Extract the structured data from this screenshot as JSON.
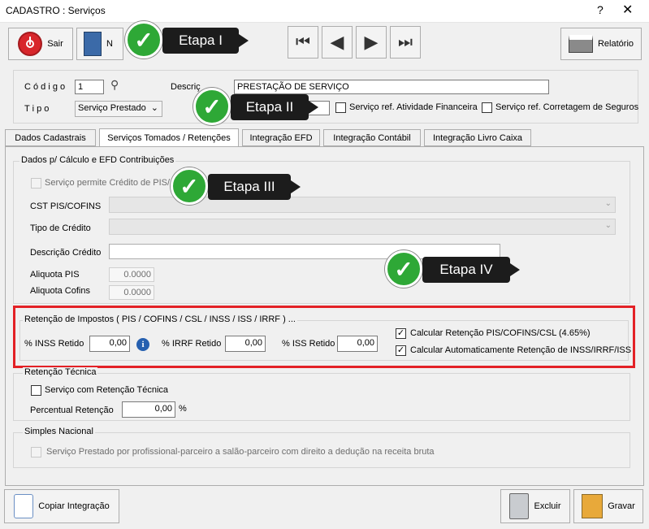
{
  "window": {
    "title": "CADASTRO : Serviços",
    "help": "?",
    "close": "✕"
  },
  "toolbar": {
    "exit_label": "Sair",
    "new_label": "N",
    "report_label": "Relatório"
  },
  "header": {
    "code_label": "C ó d i g o",
    "code_value": "1",
    "description_label": "Descriç",
    "description_value": "PRESTAÇÃO DE SERVIÇO",
    "type_label": "T i p o",
    "type_value": "Serviço Prestado",
    "chk_financial_label": "Serviço ref. Atividade Financeira",
    "chk_insurance_label": "Serviço ref. Corretagem de Seguros"
  },
  "tabs": [
    {
      "label": "Dados Cadastrais"
    },
    {
      "label": "Serviços Tomados / Retenções"
    },
    {
      "label": "Integração EFD"
    },
    {
      "label": "Integração Contábil"
    },
    {
      "label": "Integração Livro Caixa"
    }
  ],
  "pis_section": {
    "legend": "Dados p/ Cálculo e EFD Contribuições",
    "credit_check_label": "Serviço permite Crédito de PIS/",
    "cst_label": "CST PIS/COFINS",
    "credit_type_label": "Tipo de Crédito",
    "credit_desc_label": "Descrição Crédito",
    "aliq_pis_label": "Aliquota  PIS",
    "aliq_pis_value": "0.0000",
    "aliq_cofins_label": "Aliquota  Cofins",
    "aliq_cofins_value": "0.0000"
  },
  "retention": {
    "legend": "Retenção de Impostos ( PIS / COFINS / CSL / INSS / ISS / IRRF )  ...",
    "inss_label": "% INSS Retido",
    "inss_value": "0,00",
    "irrf_label": "% IRRF Retido",
    "irrf_value": "0,00",
    "iss_label": "% ISS Retido",
    "iss_value": "0,00",
    "calc_pis_label": "Calcular Retenção PIS/COFINS/CSL (4.65%)",
    "calc_auto_label": "Calcular Automaticamente Retenção de INSS/IRRF/ISS"
  },
  "technical": {
    "legend": "Retenção Técnica",
    "check_label": "Serviço com Retenção Técnica",
    "percent_label": "Percentual Retenção",
    "percent_value": "0,00",
    "percent_sign": "%"
  },
  "simples": {
    "legend": "Simples Nacional",
    "check_label": "Serviço Prestado por profissional-parceiro a salão-parceiro com direito a dedução na receita bruta"
  },
  "footer": {
    "copy_label": "Copiar Integração",
    "delete_label": "Excluir",
    "save_label": "Gravar"
  },
  "callouts": {
    "step1": "Etapa I",
    "step2": "Etapa II",
    "step3": "Etapa III",
    "step4": "Etapa IV"
  },
  "colors": {
    "highlight": "#e32126",
    "callout_bg": "#1c1c1c",
    "check_green": "#2ea836"
  }
}
